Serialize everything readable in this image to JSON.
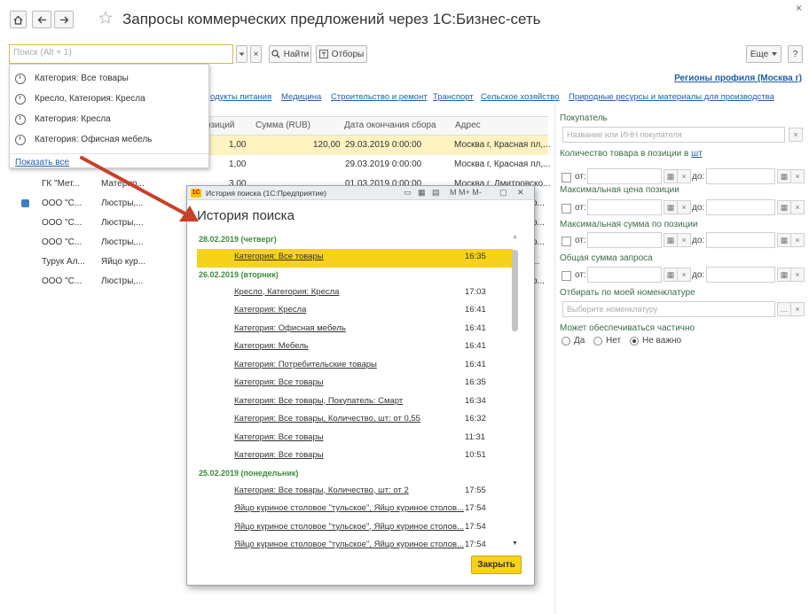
{
  "window": {
    "title": "Запросы коммерческих предложений через 1С:Бизнес-сеть",
    "close_glyph": "×"
  },
  "toolbar": {
    "home_icon": "home-icon",
    "back_icon": "arrow-left-icon",
    "forward_icon": "arrow-right-icon",
    "star_icon": "star-icon",
    "search_placeholder": "Поиск (Alt + 1)",
    "find_label": "Найти",
    "filters_label": "Отборы",
    "more_label": "Еще",
    "help_label": "?"
  },
  "dropdown": {
    "items": [
      "Категория: Все товары",
      "Кресло, Категория: Кресла",
      "Категория: Кресла",
      "Категория: Офисная мебель"
    ],
    "show_all": "Показать все"
  },
  "categories": [
    "одукты питания",
    "Медицина",
    "Строительство и ремонт",
    "Транспорт",
    "Сельское хозяйство",
    "Природные ресурсы и материалы для производства"
  ],
  "regions_link": "Регионы профиля (Москва г)",
  "table": {
    "headers": [
      "озиций",
      "Сумма (RUB)",
      "Дата окончания сбора",
      "Адрес"
    ],
    "rows": [
      {
        "c1": "",
        "c2": "",
        "qty": "1,00",
        "sum": "120,00",
        "date": "29.03.2019 0:00:00",
        "addr": "Москва г, Красная пл,..."
      },
      {
        "c1": "",
        "c2": "",
        "qty": "1,00",
        "sum": "",
        "date": "29.03.2019 0:00:00",
        "addr": "Москва г, Красная пл,..."
      },
      {
        "c1": "ГК \"Мет...",
        "c2": "Материр...",
        "qty": "3,00",
        "sum": "",
        "date": "01.03.2019 0:00:00",
        "addr": "Москва г, Дмитровско..."
      },
      {
        "c1": "ООО \"С...",
        "c2": "Люстры,...",
        "qty": "",
        "sum": "",
        "date": "",
        "addr": "р..."
      },
      {
        "c1": "ООО \"С...",
        "c2": "Люстры,...",
        "qty": "",
        "sum": "",
        "date": "",
        "addr": "р..."
      },
      {
        "c1": "ООО \"С...",
        "c2": "Люстры,...",
        "qty": "",
        "sum": "",
        "date": "",
        "addr": "р..."
      },
      {
        "c1": "Турук Ал...",
        "c2": "Яйцо кур...",
        "qty": "",
        "sum": "",
        "date": "",
        "addr": "..."
      },
      {
        "c1": "ООО \"С...",
        "c2": "Люстры,...",
        "qty": "",
        "sum": "",
        "date": "",
        "addr": "р..."
      }
    ]
  },
  "filters": {
    "buyer_label": "Покупатель",
    "buyer_placeholder": "Название или ИНН покупателя",
    "qty_label": "Количество товара в позиции в",
    "qty_unit": "шт",
    "from": "от:",
    "to": "до:",
    "max_price_label": "Максимальная цена позиции",
    "max_sum_label": "Максимальная сумма по позиции",
    "total_label": "Общая сумма запроса",
    "nomenclature_label": "Отбирать по моей номенклатуре",
    "nomenclature_placeholder": "Выберите номенклатуру",
    "partial_label": "Может обеспечиваться частично",
    "radio_yes": "Да",
    "radio_no": "Нет",
    "radio_any": "Не важно"
  },
  "history": {
    "window_title": "История поиска  (1С:Предприятие)",
    "win_controls": "M  M+  M-",
    "heading": "История поиска",
    "groups": [
      {
        "date": "28.02.2019 (четверг)",
        "items": [
          {
            "text": "Категория: Все товары",
            "time": "16:35"
          }
        ]
      },
      {
        "date": "26.02.2019 (вторник)",
        "items": [
          {
            "text": "Кресло, Категория: Кресла",
            "time": "17:03"
          },
          {
            "text": "Категория: Кресла",
            "time": "16:41"
          },
          {
            "text": "Категория: Офисная мебель",
            "time": "16:41"
          },
          {
            "text": "Категория: Мебель",
            "time": "16:41"
          },
          {
            "text": "Категория: Потребительские товары",
            "time": "16:41"
          },
          {
            "text": "Категория: Все товары",
            "time": "16:35"
          },
          {
            "text": "Категория: Все товары, Покупатель: Смарт",
            "time": "16:34"
          },
          {
            "text": "Категория: Все товары, Количество, шт: от 0,55",
            "time": "16:32"
          },
          {
            "text": "Категория: Все товары",
            "time": "11:31"
          },
          {
            "text": "Категория: Все товары",
            "time": "10:51"
          }
        ]
      },
      {
        "date": "25.02.2019 (понедельник)",
        "items": [
          {
            "text": "Категория: Все товары, Количество, шт: от 2",
            "time": "17:55"
          },
          {
            "text": "Яйцо куриное столовое \"тульское\", Яйцо куриное столов...",
            "time": "17:54"
          },
          {
            "text": "Яйцо куриное столовое \"тульское\", Яйцо куриное столов...",
            "time": "17:54"
          },
          {
            "text": "Яйцо куриное столовое \"тульское\", Яйцо куриное столов...",
            "time": "17:54"
          }
        ]
      }
    ],
    "close_label": "Закрыть"
  },
  "colors": {
    "accent_yellow": "#f7d21a",
    "link_blue": "#1f5fa8",
    "group_green": "#3b8b3b",
    "arrow_red": "#c8402a"
  }
}
